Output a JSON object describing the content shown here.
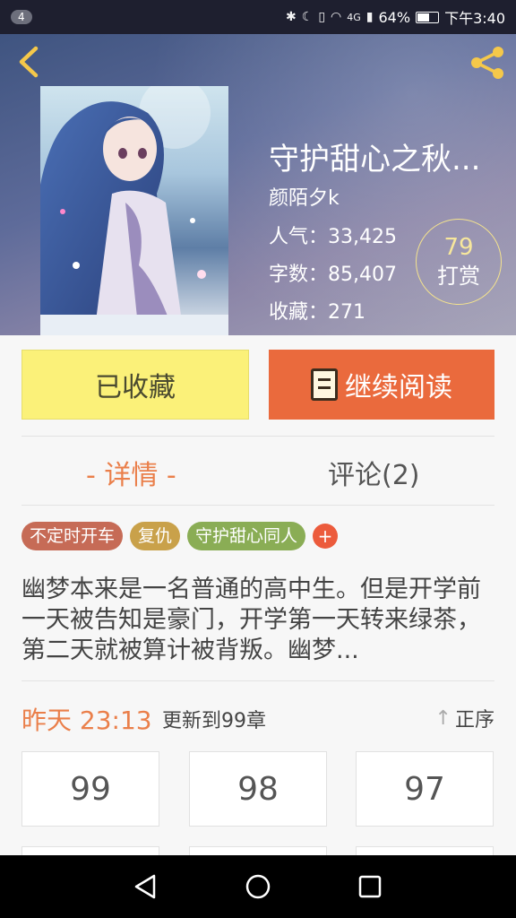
{
  "status_bar": {
    "notification_count": "4",
    "network": "4G",
    "battery": "64%",
    "battery_fraction": 0.64,
    "time": "下午3:40"
  },
  "book": {
    "title": "守护甜心之秋...",
    "author": "颜陌夕k",
    "popularity": "人气：33,425",
    "word_count": "字数：85,407",
    "favorites": "收藏：271",
    "reward_count": "79",
    "reward_label": "打赏"
  },
  "actions": {
    "collected_label": "已收藏",
    "continue_label": "继续阅读"
  },
  "tabs": {
    "details": "- 详情 -",
    "comments": "评论(2)"
  },
  "tags": [
    "不定时开车",
    "复仇",
    "守护甜心同人"
  ],
  "tag_add": "+",
  "description": "幽梦本来是一名普通的高中生。但是开学前一天被告知是豪门，开学第一天转来绿茶，第二天就被算计被背叛。幽梦...",
  "update": {
    "time": "昨天 23:13",
    "text": "更新到99章",
    "order_label": "正序"
  },
  "chapters": [
    "99",
    "98",
    "97"
  ],
  "colors": {
    "accent_orange": "#ea6a3d",
    "collected_yellow": "#fbf179",
    "tab_active": "#ea7f4a"
  },
  "icons": [
    "back-icon",
    "share-icon",
    "book-icon",
    "sort-arrow-icon",
    "nav-back-icon",
    "nav-home-icon",
    "nav-recents-icon"
  ]
}
